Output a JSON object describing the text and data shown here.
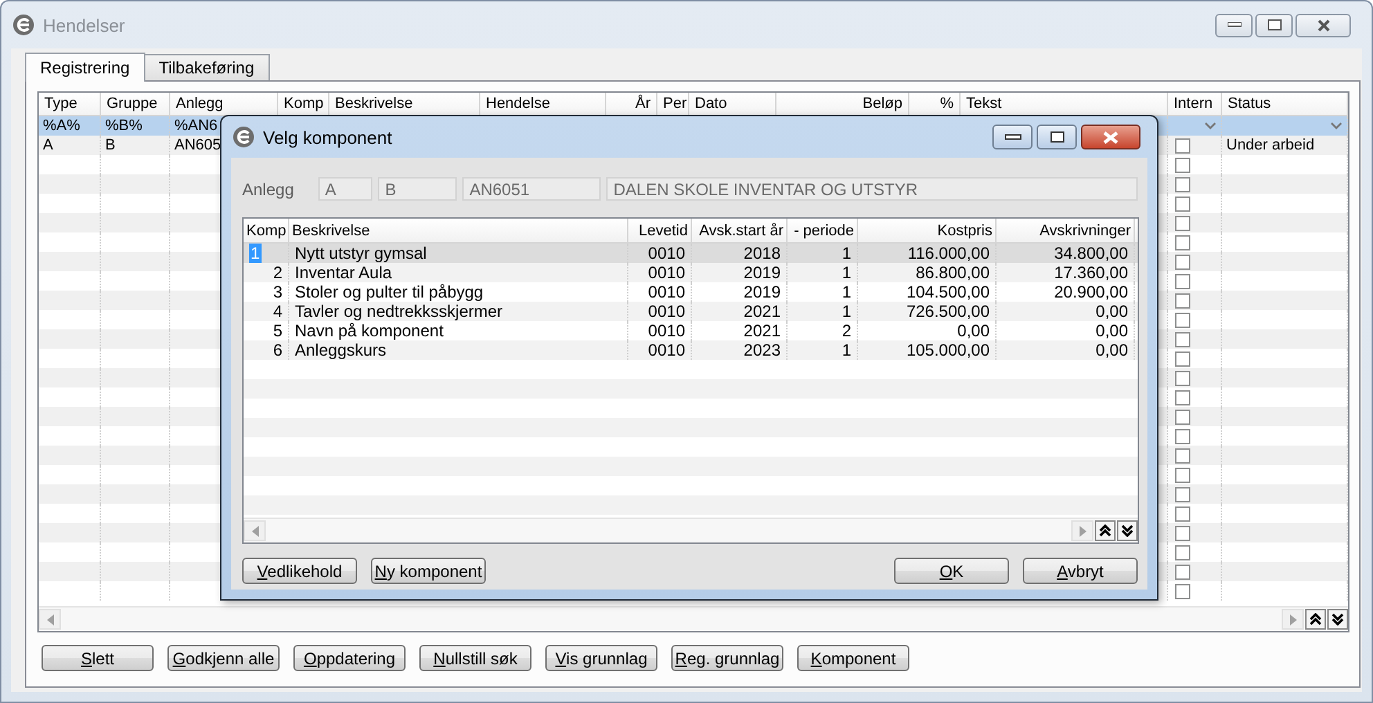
{
  "window": {
    "title": "Hendelser"
  },
  "tabs": [
    {
      "label": "Registrering",
      "selected": true
    },
    {
      "label": "Tilbakeføring",
      "selected": false
    }
  ],
  "grid": {
    "columns": [
      "Type",
      "Gruppe",
      "Anlegg",
      "Komp",
      "Beskrivelse",
      "Hendelse",
      "År",
      "Per",
      "Dato",
      "Beløp",
      "%",
      "Tekst",
      "Intern",
      "Status"
    ],
    "rows": [
      {
        "kind": "filter",
        "selected": true,
        "cells": [
          "%A%",
          "%B%",
          "%AN6"
        ]
      },
      {
        "kind": "row",
        "selected": false,
        "cells": [
          "A",
          "B",
          "AN605"
        ],
        "intern": false,
        "status": "Under arbeid"
      },
      {
        "kind": "row",
        "selected": false,
        "intern": false
      },
      {
        "kind": "row",
        "selected": false,
        "intern": false
      },
      {
        "kind": "row",
        "selected": false,
        "intern": false
      },
      {
        "kind": "row",
        "selected": false,
        "intern": false
      },
      {
        "kind": "row",
        "selected": false,
        "intern": false
      },
      {
        "kind": "row",
        "selected": false,
        "intern": false
      },
      {
        "kind": "row",
        "selected": false,
        "intern": false
      },
      {
        "kind": "row",
        "selected": false,
        "intern": false
      },
      {
        "kind": "row",
        "selected": false,
        "intern": false
      },
      {
        "kind": "row",
        "selected": false,
        "intern": false
      },
      {
        "kind": "row",
        "selected": false,
        "intern": false
      },
      {
        "kind": "row",
        "selected": false,
        "intern": false
      },
      {
        "kind": "row",
        "selected": false,
        "intern": false
      },
      {
        "kind": "row",
        "selected": false,
        "intern": false
      },
      {
        "kind": "row",
        "selected": false,
        "intern": false
      },
      {
        "kind": "row",
        "selected": false,
        "intern": false
      },
      {
        "kind": "row",
        "selected": false,
        "intern": false
      },
      {
        "kind": "row",
        "selected": false,
        "intern": false
      },
      {
        "kind": "row",
        "selected": false,
        "intern": false
      },
      {
        "kind": "row",
        "selected": false,
        "intern": false
      },
      {
        "kind": "row",
        "selected": false,
        "intern": false
      },
      {
        "kind": "row",
        "selected": false,
        "intern": false
      },
      {
        "kind": "row",
        "selected": false,
        "intern": false
      }
    ]
  },
  "buttons": [
    "Slett",
    "Godkjenn alle",
    "Oppdatering",
    "Nullstill søk",
    "Vis grunnlag",
    "Reg. grunnlag",
    "Komponent"
  ],
  "dialog": {
    "title": "Velg komponent",
    "anlegg_label": "Anlegg",
    "anlegg_fields": [
      "A",
      "B",
      "AN6051",
      "DALEN SKOLE INVENTAR OG UTSTYR"
    ],
    "columns": [
      "Komp",
      "Beskrivelse",
      "Levetid",
      "Avsk.start år",
      "- periode",
      "Kostpris",
      "Avskrivninger"
    ],
    "rows": [
      {
        "selected": true,
        "cells": [
          "1",
          "Nytt utstyr gymsal",
          "0010",
          "2018",
          "1",
          "116.000,00",
          "34.800,00"
        ]
      },
      {
        "selected": false,
        "cells": [
          "2",
          "Inventar Aula",
          "0010",
          "2019",
          "1",
          "86.800,00",
          "17.360,00"
        ]
      },
      {
        "selected": false,
        "cells": [
          "3",
          "Stoler og pulter til påbygg",
          "0010",
          "2019",
          "1",
          "104.500,00",
          "20.900,00"
        ]
      },
      {
        "selected": false,
        "cells": [
          "4",
          "Tavler og nedtrekksskjermer",
          "0010",
          "2021",
          "1",
          "726.500,00",
          "0,00"
        ]
      },
      {
        "selected": false,
        "cells": [
          "5",
          "Navn på komponent",
          "0010",
          "2021",
          "2",
          "0,00",
          "0,00"
        ]
      },
      {
        "selected": false,
        "cells": [
          "6",
          "Anleggskurs",
          "0010",
          "2023",
          "1",
          "105.000,00",
          "0,00"
        ]
      }
    ],
    "buttons": [
      "Vedlikehold",
      "Ny komponent"
    ],
    "actions": [
      "OK",
      "Avbryt"
    ]
  }
}
